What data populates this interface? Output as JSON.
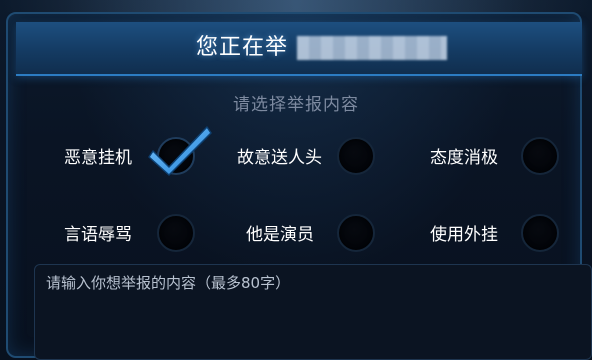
{
  "dialog": {
    "title": "您正在举",
    "subtitle": "请选择举报内容"
  },
  "options": [
    {
      "label": "恶意挂机",
      "selected": true
    },
    {
      "label": "故意送人头",
      "selected": false
    },
    {
      "label": "态度消极",
      "selected": false
    },
    {
      "label": "言语辱骂",
      "selected": false
    },
    {
      "label": "他是演员",
      "selected": false
    },
    {
      "label": "使用外挂",
      "selected": false
    }
  ],
  "input": {
    "placeholder": "请输入你想举报的内容（最多80字）"
  },
  "colors": {
    "accent": "#2c7cc2",
    "check": "#3aa0f0",
    "title_bar": "#1d4f80"
  },
  "icons": {
    "checkmark": "check-icon",
    "radio": "radio-circle"
  }
}
